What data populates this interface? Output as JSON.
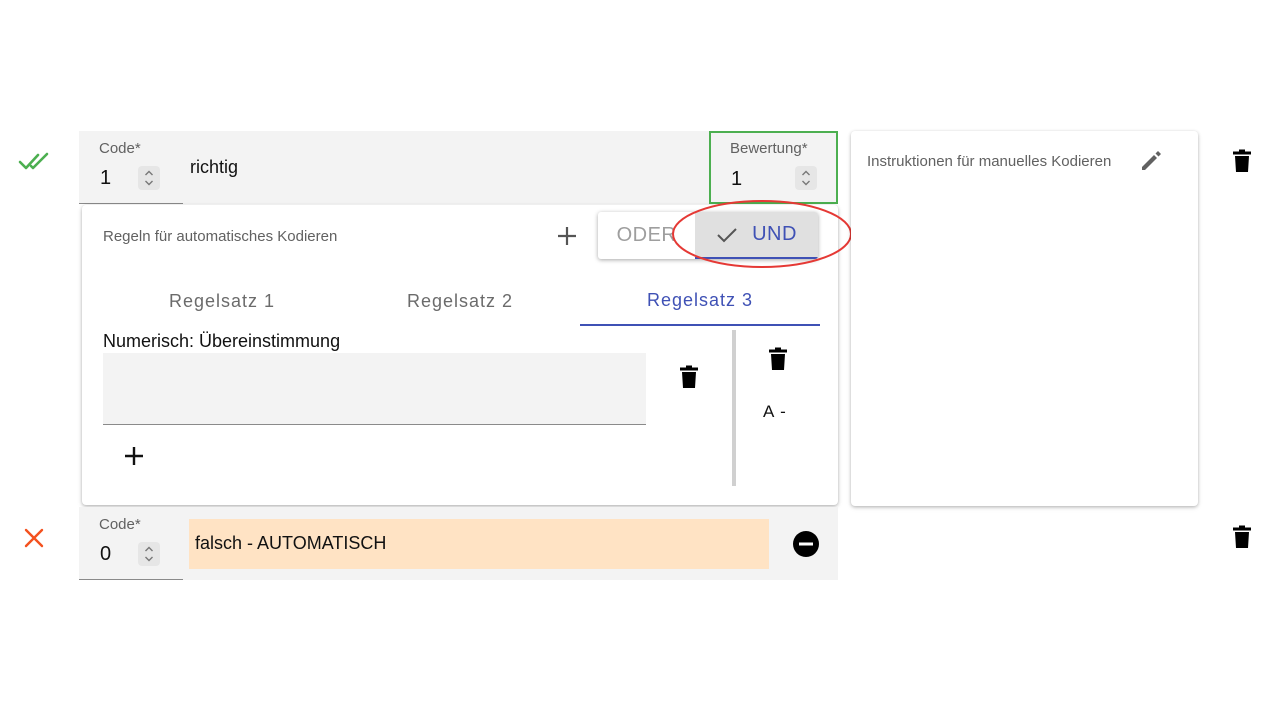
{
  "code_rows": [
    {
      "status_icon": "double-check-icon",
      "status_color": "#4caf50",
      "code_label": "Code*",
      "code_value": "1",
      "description": "richtig",
      "score_label": "Bewertung*",
      "score_value": "1"
    },
    {
      "status_icon": "close-icon",
      "status_color": "#f4511e",
      "code_label": "Code*",
      "code_value": "0",
      "description": "falsch - AUTOMATISCH",
      "description_bg": "#ffe3c4"
    }
  ],
  "rules_panel": {
    "title": "Regeln für automatisches Kodieren",
    "add_icon": "plus-icon",
    "operator_toggle": {
      "options": [
        "ODER",
        "UND"
      ],
      "selected": "UND",
      "selected_icon": "check-icon"
    },
    "tabs": [
      "Regelsatz 1",
      "Regelsatz 2",
      "Regelsatz 3"
    ],
    "active_tab": "Regelsatz 3",
    "rule": {
      "label": "Numerisch: Übereinstimmung",
      "value": ""
    },
    "side_text": "A -"
  },
  "instructions": {
    "label": "Instruktionen für manuelles Kodieren",
    "edit_icon": "pencil-icon"
  },
  "colors": {
    "accent": "#3f51b5",
    "highlight_box": "#4caf50",
    "annotation_ellipse": "#e53935"
  }
}
